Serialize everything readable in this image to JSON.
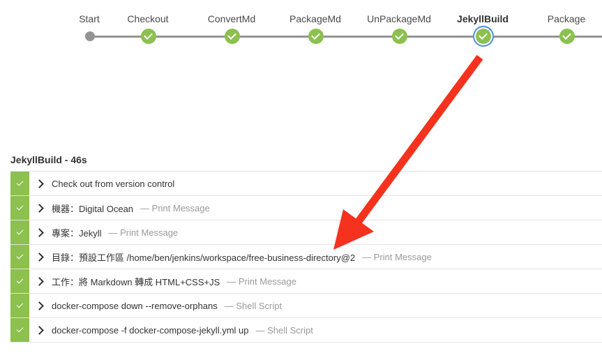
{
  "pipeline": {
    "stages": [
      {
        "label": "Start",
        "status": "start"
      },
      {
        "label": "Checkout",
        "status": "success"
      },
      {
        "label": "ConvertMd",
        "status": "success"
      },
      {
        "label": "PackageMd",
        "status": "success"
      },
      {
        "label": "UnPackageMd",
        "status": "success"
      },
      {
        "label": "JekyllBuild",
        "status": "selected"
      },
      {
        "label": "Package",
        "status": "success"
      }
    ]
  },
  "detail": {
    "title": "JekyllBuild - 46s",
    "steps": [
      {
        "text": "Check out from version control",
        "type": ""
      },
      {
        "text": "機器：Digital Ocean",
        "type": "— Print Message"
      },
      {
        "text": "專案：Jekyll",
        "type": "— Print Message"
      },
      {
        "text": "目錄：預設工作區 /home/ben/jenkins/workspace/free-business-directory@2",
        "type": "— Print Message"
      },
      {
        "text": "工作：將 Markdown 轉成 HTML+CSS+JS",
        "type": "— Print Message"
      },
      {
        "text": "docker-compose down --remove-orphans",
        "type": "— Shell Script"
      },
      {
        "text": "docker-compose -f docker-compose-jekyll.yml up",
        "type": "— Shell Script"
      }
    ]
  },
  "colors": {
    "success": "#8cc04f",
    "selected_ring": "#4a90e2",
    "annotation": "#f5321e"
  },
  "icons": {
    "status": "check-icon",
    "expand": "chevron-right-icon",
    "annotation": "red-arrow"
  }
}
